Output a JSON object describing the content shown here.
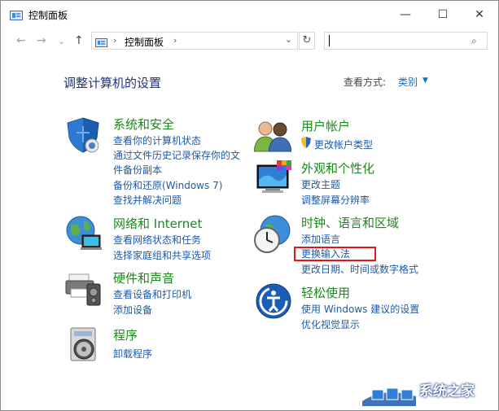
{
  "window": {
    "title": "控制面板",
    "controls": {
      "minimize": "—",
      "maximize": "☐",
      "close": "✕"
    }
  },
  "navbar": {
    "back": "←",
    "forward": "→",
    "recent": "⌄",
    "up": "↑",
    "breadcrumb": "控制面板",
    "separator": "›",
    "dropdown": "⌄",
    "refresh": "↻",
    "search_icon": "⌕",
    "search_value": ""
  },
  "content": {
    "heading": "调整计算机的设置",
    "view_by_label": "查看方式:",
    "view_by_value": "类别",
    "view_by_arrow": "▼"
  },
  "categories": [
    {
      "name": "system-security",
      "title": "系统和安全",
      "icon": "shield-icon",
      "links": [
        "查看你的计算机状态",
        "通过文件历史记录保存你的文",
        "件备份副本",
        "备份和还原(Windows 7)",
        "查找并解决问题"
      ]
    },
    {
      "name": "network-internet",
      "title": "网络和 Internet",
      "icon": "globe-network-icon",
      "links": [
        "查看网络状态和任务",
        "选择家庭组和共享选项"
      ]
    },
    {
      "name": "hardware-sound",
      "title": "硬件和声音",
      "icon": "printer-icon",
      "links": [
        "查看设备和打印机",
        "添加设备"
      ]
    },
    {
      "name": "programs",
      "title": "程序",
      "icon": "programs-disc-icon",
      "links": [
        "卸载程序"
      ]
    },
    {
      "name": "user-accounts",
      "title": "用户帐户",
      "icon": "users-icon",
      "links": [
        "更改帐户类型"
      ]
    },
    {
      "name": "appearance",
      "title": "外观和个性化",
      "icon": "monitor-personalize-icon",
      "links": [
        "更改主题",
        "调整屏幕分辨率"
      ]
    },
    {
      "name": "clock-language-region",
      "title": "时钟、语言和区域",
      "icon": "clock-globe-icon",
      "links": [
        "添加语言",
        "更换输入法",
        "更改日期、时间或数字格式"
      ]
    },
    {
      "name": "ease-of-access",
      "title": "轻松使用",
      "icon": "ease-of-access-icon",
      "links": [
        "使用 Windows 建议的设置",
        "优化视觉显示"
      ]
    }
  ],
  "watermark": {
    "text": "系统之家"
  },
  "colors": {
    "heading": "#1e3287",
    "category": "#1a8a1a",
    "link": "#1e5aa8",
    "highlight": "#e0161b"
  }
}
